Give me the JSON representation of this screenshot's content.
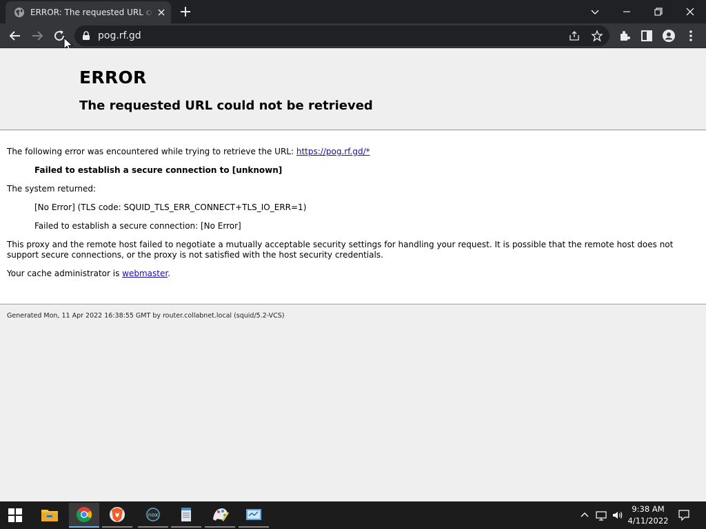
{
  "browser": {
    "tab_title": "ERROR: The requested URL could not be retrieved",
    "url": "pog.rf.gd"
  },
  "page": {
    "heading": "ERROR",
    "subheading": "The requested URL could not be retrieved",
    "intro_text": "The following error was encountered while trying to retrieve the URL: ",
    "intro_link": "https://pog.rf.gd/*",
    "error_summary": "Failed to establish a secure connection to [unknown]",
    "system_returned_label": "The system returned:",
    "system_error_1": "[No Error] (TLS code: SQUID_TLS_ERR_CONNECT+TLS_IO_ERR=1)",
    "system_error_2": "Failed to establish a secure connection: [No Error]",
    "explanation": "This proxy and the remote host failed to negotiate a mutually acceptable security settings for handling your request. It is possible that the remote host does not support secure connections, or the proxy is not satisfied with the host security credentials.",
    "admin_text": "Your cache administrator is ",
    "admin_link": "webmaster",
    "admin_suffix": ".",
    "footer": "Generated Mon, 11 Apr 2022 16:38:55 GMT by router.collabnet.local (squid/5.2-VCS)"
  },
  "taskbar": {
    "apps": [
      "start-icon",
      "file-explorer-icon",
      "chrome-icon",
      "brave-icon",
      "nox-icon",
      "notepad-icon",
      "paint-icon",
      "control-panel-icon"
    ],
    "time": "9:38 AM",
    "date": "4/11/2022"
  },
  "colors": {
    "titlebar": "#202124",
    "toolbar": "#35363a",
    "page_bg": "#efefef",
    "link": "#1a0dab",
    "taskbar": "#1c1c1c"
  }
}
